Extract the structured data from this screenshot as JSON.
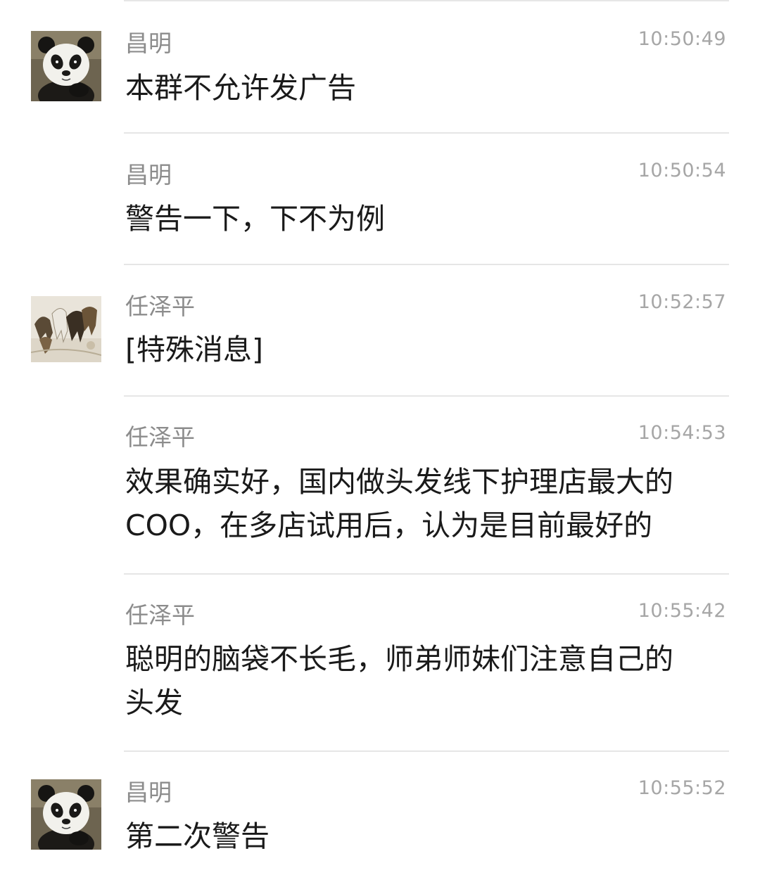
{
  "messages": [
    {
      "sender": "昌明",
      "time": "10:50:49",
      "avatar": "panda-avatar",
      "lines": [
        "本群不允许发广告"
      ]
    },
    {
      "sender": "昌明",
      "time": "10:50:54",
      "avatar": "",
      "lines": [
        "警告一下，下不为例"
      ]
    },
    {
      "sender": "任泽平",
      "time": "10:52:57",
      "avatar": "horses-painting-avatar",
      "lines": [
        "[特殊消息]"
      ]
    },
    {
      "sender": "任泽平",
      "time": "10:54:53",
      "avatar": "",
      "lines": [
        "效果确实好，国内做头发线下护理店最大的",
        "COO，在多店试用后，认为是目前最好的"
      ]
    },
    {
      "sender": "任泽平",
      "time": "10:55:42",
      "avatar": "",
      "lines": [
        "聪明的脑袋不长毛，师弟师妹们注意自己的",
        "头发"
      ]
    },
    {
      "sender": "昌明",
      "time": "10:55:52",
      "avatar": "panda-avatar",
      "lines": [
        "第二次警告"
      ]
    }
  ],
  "colors": {
    "divider": "#e6e6e6",
    "sender": "#8c8c8c",
    "time": "#a6a6a6",
    "text": "#1a1a1a"
  }
}
